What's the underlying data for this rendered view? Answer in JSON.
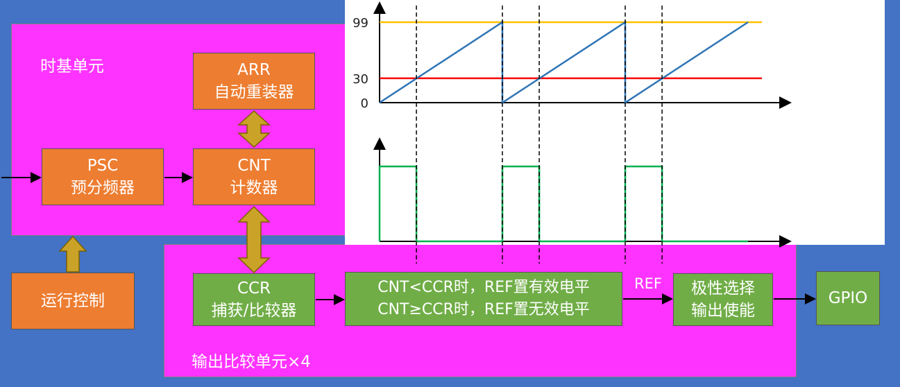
{
  "time_base": {
    "title": "时基单元",
    "arr": {
      "line1": "ARR",
      "line2": "自动重装器"
    },
    "psc": {
      "line1": "PSC",
      "line2": "预分频器"
    },
    "cnt": {
      "line1": "CNT",
      "line2": "计数器"
    }
  },
  "run_control": "运行控制",
  "output_compare": {
    "title": "输出比较单元×4",
    "ccr": {
      "line1": "CCR",
      "line2": "捕获/比较器"
    },
    "compare": {
      "line1": "CNT<CCR时，REF置有效电平",
      "line2": "CNT≥CCR时，REF置无效电平"
    },
    "ref_label": "REF",
    "polarity": {
      "line1": "极性选择",
      "line2": "输出使能"
    },
    "gpio": "GPIO"
  },
  "colors": {
    "panel": "#FF33FF",
    "background": "#4472C4",
    "orange_block": "#ED7D31",
    "green_block": "#70AD47",
    "arrow_fill": "#C9A227",
    "arr_line": "#FFC000",
    "ccr_line": "#FF0000",
    "cnt_wave": "#2E75B6",
    "pwm_wave": "#00B050"
  },
  "chart_data": [
    {
      "type": "line",
      "y_tick_labels": [
        "99",
        "30",
        "0"
      ],
      "ylim": [
        0,
        99
      ],
      "series": [
        {
          "role": "cnt_sawtooth",
          "points": [
            [
              0,
              0
            ],
            [
              1,
              99
            ],
            [
              1,
              0
            ],
            [
              2,
              99
            ],
            [
              2,
              0
            ],
            [
              3,
              99
            ]
          ]
        },
        {
          "role": "arr_level",
          "value": 99
        },
        {
          "role": "ccr_level",
          "value": 30
        }
      ],
      "cycles": 3
    },
    {
      "type": "line",
      "series": [
        {
          "role": "ref_pwm",
          "duty": 0.3,
          "high_when": "CNT<CCR"
        }
      ],
      "cycles": 3
    }
  ]
}
